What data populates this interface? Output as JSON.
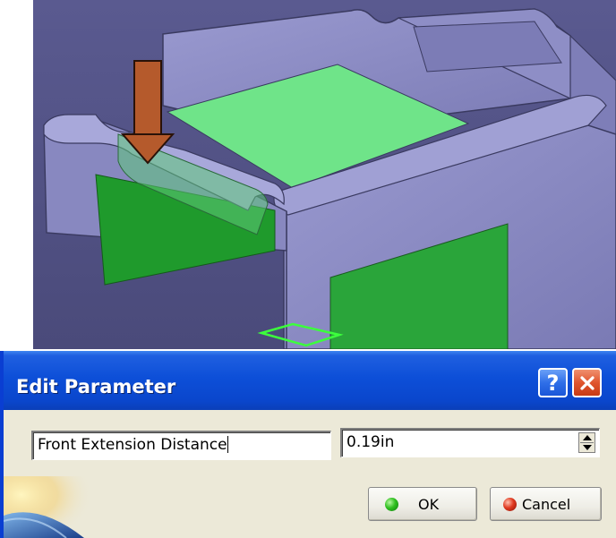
{
  "dialog": {
    "title": "Edit Parameter",
    "help_label": "?",
    "parameter_name": "Front Extension Distance",
    "parameter_value": "0.19in",
    "ok_label": "OK",
    "cancel_label": "Cancel"
  },
  "icons": {
    "help": "help-icon",
    "close": "close-icon",
    "ok": "green-status-icon",
    "cancel": "red-status-icon",
    "spinner_up": "arrow-up-icon",
    "spinner_down": "arrow-down-icon",
    "logo": "catia-logo-icon"
  },
  "colors": {
    "viewport_background": "#5a5a8c",
    "part_body": "#8a8ac0",
    "highlight_green": "#6ee08a",
    "dark_green_face": "#1a9a2a",
    "arrow": "#b85a2a",
    "titlebar_blue": "#0a46cc",
    "dialog_background": "#ece9d8"
  }
}
